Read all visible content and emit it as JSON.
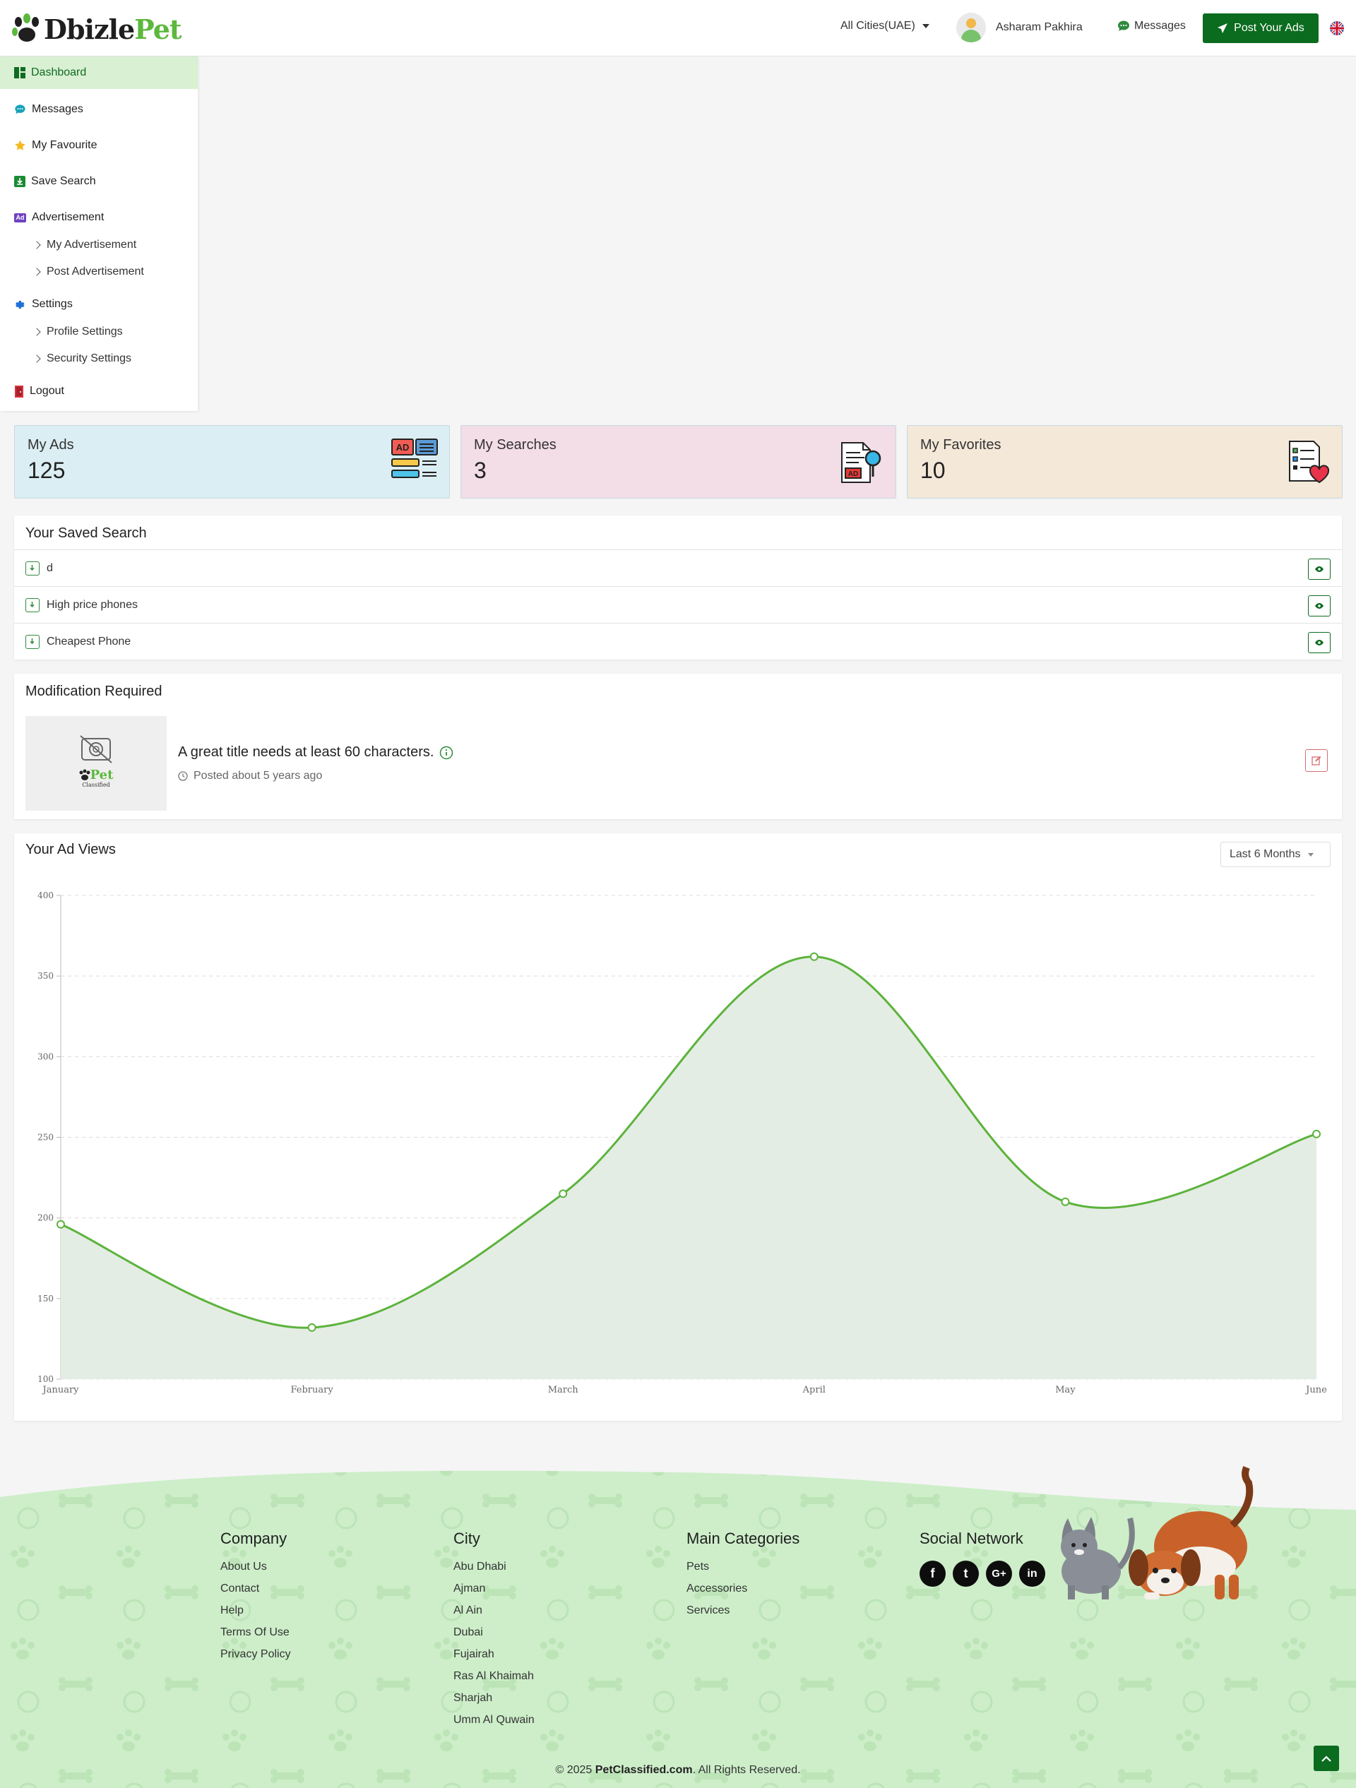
{
  "header": {
    "logo_a": "Dbizle",
    "logo_b": "Pet",
    "city": "All Cities(UAE)",
    "user_name": "Asharam Pakhira",
    "messages": "Messages",
    "post_button": "Post Your Ads"
  },
  "sidebar": {
    "dashboard": "Dashboard",
    "messages": "Messages",
    "favourite": "My Favourite",
    "save_search": "Save Search",
    "advertisement": "Advertisement",
    "my_advertisement": "My Advertisement",
    "post_advertisement": "Post Advertisement",
    "settings": "Settings",
    "profile_settings": "Profile Settings",
    "security_settings": "Security Settings",
    "logout": "Logout",
    "ad_badge": "Ad"
  },
  "stats": [
    {
      "label": "My Ads",
      "value": "125",
      "bg": "#dbeef3",
      "icon_text": "AD"
    },
    {
      "label": "My Searches",
      "value": "3",
      "bg": "#f3dde6",
      "icon_text": "AD"
    },
    {
      "label": "My Favorites",
      "value": "10",
      "bg": "#f4e8d9"
    }
  ],
  "saved_search": {
    "title": "Your Saved Search",
    "rows": [
      "d",
      "High price phones",
      "Cheapest Phone"
    ]
  },
  "modification": {
    "title": "Modification Required",
    "ad_title": "A great title needs at least 60 characters.",
    "posted": "Posted about 5 years ago",
    "thumb_logo": "Pet",
    "thumb_sub": "Classified"
  },
  "ad_views": {
    "title": "Your Ad Views",
    "range": "Last 6 Months"
  },
  "chart_data": {
    "type": "area",
    "categories": [
      "January",
      "February",
      "March",
      "April",
      "May",
      "June"
    ],
    "values": [
      196,
      132,
      215,
      362,
      210,
      252
    ],
    "ylim": [
      100,
      400
    ],
    "yticks": [
      100,
      150,
      200,
      250,
      300,
      350,
      400
    ],
    "grid": true,
    "line_color": "#5cb33c",
    "fill_color": "#e4ede4",
    "title": "",
    "xlabel": "",
    "ylabel": ""
  },
  "footer": {
    "company": {
      "title": "Company",
      "links": [
        "About Us",
        "Contact",
        "Help",
        "Terms Of Use",
        "Privacy Policy"
      ]
    },
    "city": {
      "title": "City",
      "links": [
        "Abu Dhabi",
        "Ajman",
        "Al Ain",
        "Dubai",
        "Fujairah",
        "Ras Al Khaimah",
        "Sharjah",
        "Umm Al Quwain"
      ]
    },
    "categories": {
      "title": "Main Categories",
      "links": [
        "Pets",
        "Accessories",
        "Services"
      ]
    },
    "social": {
      "title": "Social Network",
      "icons": [
        "f",
        "t",
        "G+",
        "in"
      ]
    },
    "copyright_pre": "© 2025 ",
    "copyright_site": "PetClassified.com",
    "copyright_post": ". All Rights Reserved."
  },
  "colors": {
    "brand_green": "#0b6b1e",
    "accent_green": "#5cb83c",
    "footer_bg": "#cdeec9"
  }
}
